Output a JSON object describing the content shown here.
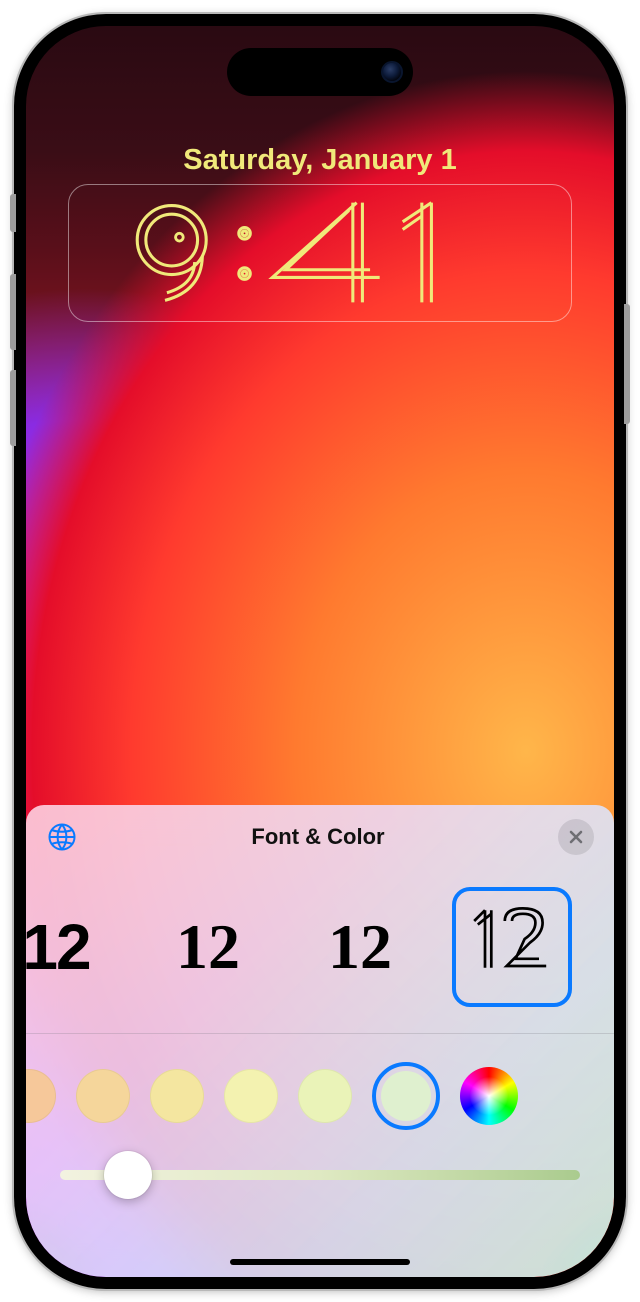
{
  "lockscreen": {
    "date": "Saturday, January 1",
    "time": "9:41"
  },
  "sheet": {
    "title": "Font & Color",
    "font_options": [
      {
        "sample": "12",
        "style": "stencil",
        "selected": false
      },
      {
        "sample": "12",
        "style": "serif",
        "selected": false
      },
      {
        "sample": "12",
        "style": "slab",
        "selected": false
      },
      {
        "sample": "12",
        "style": "outline",
        "selected": true
      }
    ],
    "color_swatches": [
      {
        "hex": "#f6c89a",
        "selected": false
      },
      {
        "hex": "#f5d69b",
        "selected": false
      },
      {
        "hex": "#f4e6a0",
        "selected": false
      },
      {
        "hex": "#f3f2b0",
        "selected": false
      },
      {
        "hex": "#eaf3b8",
        "selected": false
      },
      {
        "hex": "#dff0cf",
        "selected": true
      }
    ],
    "slider_value_pct": 13
  }
}
